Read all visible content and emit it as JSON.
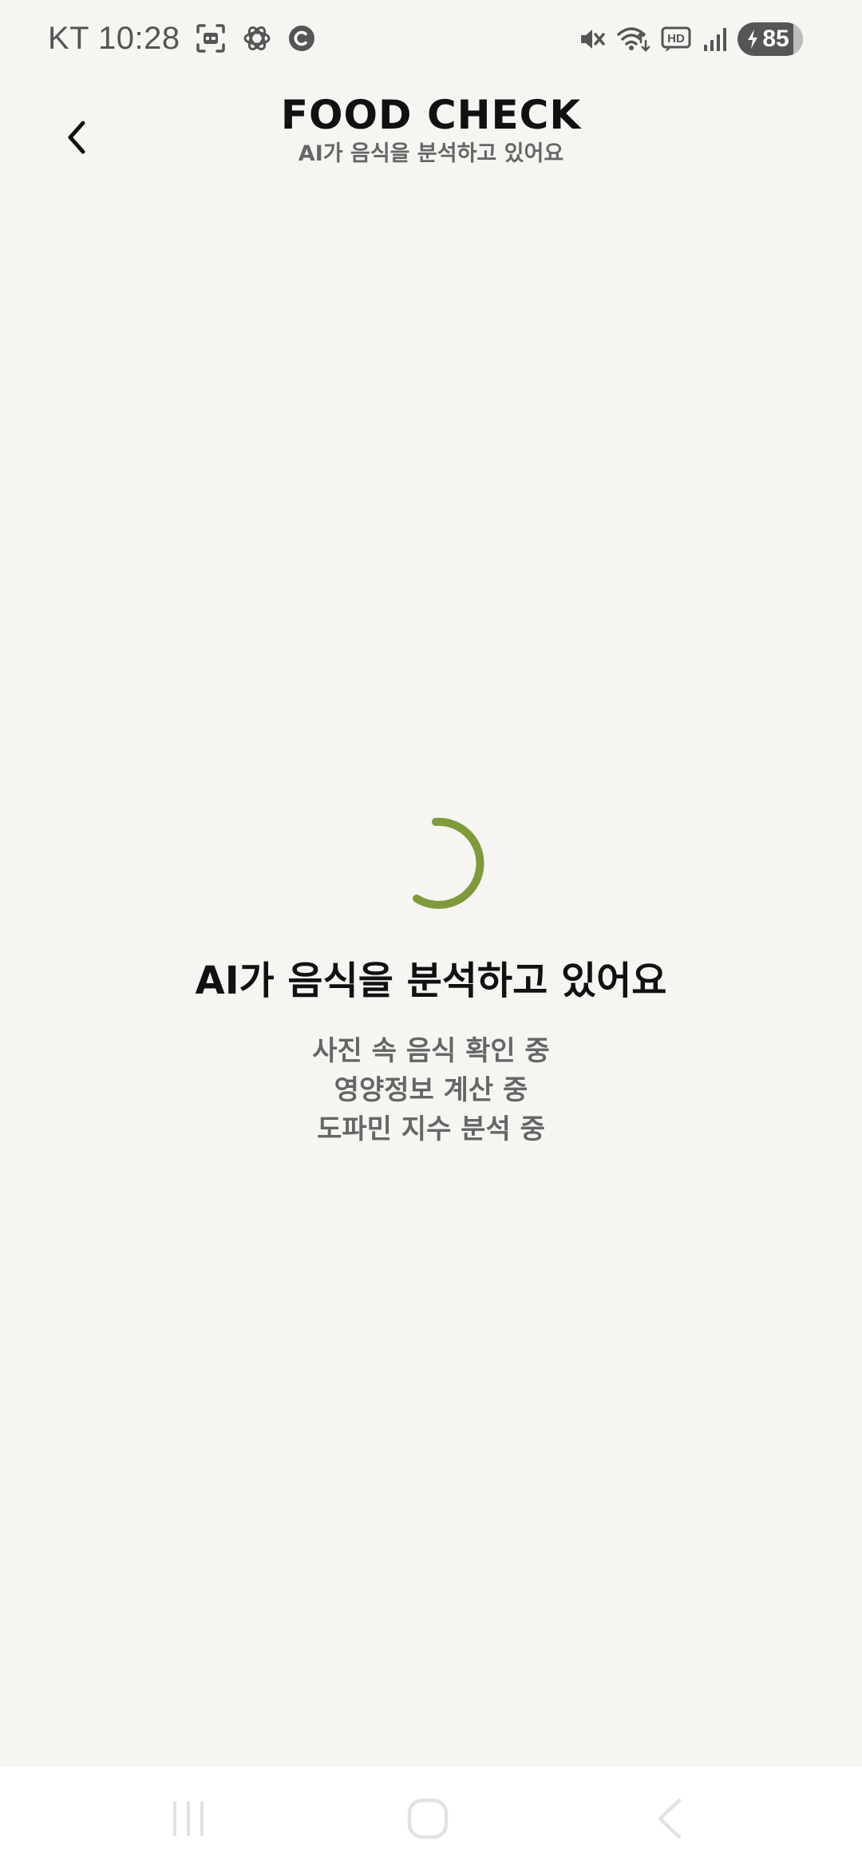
{
  "status_bar": {
    "time": "KT 10:28",
    "battery": "85",
    "icons_left": [
      "scan-icon",
      "openai-icon",
      "c-badge-icon"
    ],
    "icons_right": [
      "mute-icon",
      "wifi-icon",
      "hd-icon",
      "signal-icon",
      "battery-icon"
    ]
  },
  "header": {
    "title": "FOOD CHECK",
    "subtitle": "AI가 음식을 분석하고 있어요"
  },
  "loading": {
    "title": "AI가 음식을 분석하고 있어요",
    "steps": [
      "사진 속 음식 확인 중",
      "영양정보 계산 중",
      "도파민 지수 분석 중"
    ],
    "spinner_color": "#7e9a3a"
  },
  "nav": {
    "buttons": [
      "recents-icon",
      "home-icon",
      "back-icon"
    ]
  },
  "colors": {
    "background": "#f6f5f2",
    "accent": "#7e9a3a",
    "text_primary": "#111111",
    "text_secondary": "#666666"
  }
}
